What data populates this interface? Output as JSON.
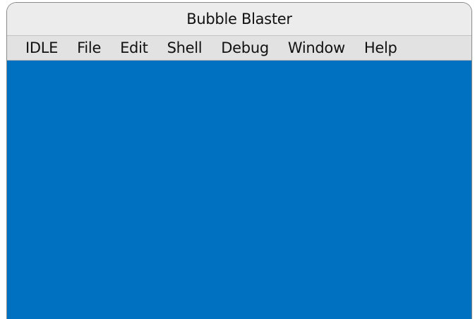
{
  "window": {
    "title": "Bubble Blaster"
  },
  "menubar": {
    "items": [
      {
        "label": "IDLE"
      },
      {
        "label": "File"
      },
      {
        "label": "Edit"
      },
      {
        "label": "Shell"
      },
      {
        "label": "Debug"
      },
      {
        "label": "Window"
      },
      {
        "label": "Help"
      }
    ]
  },
  "canvas": {
    "background_color": "#0070c0"
  }
}
